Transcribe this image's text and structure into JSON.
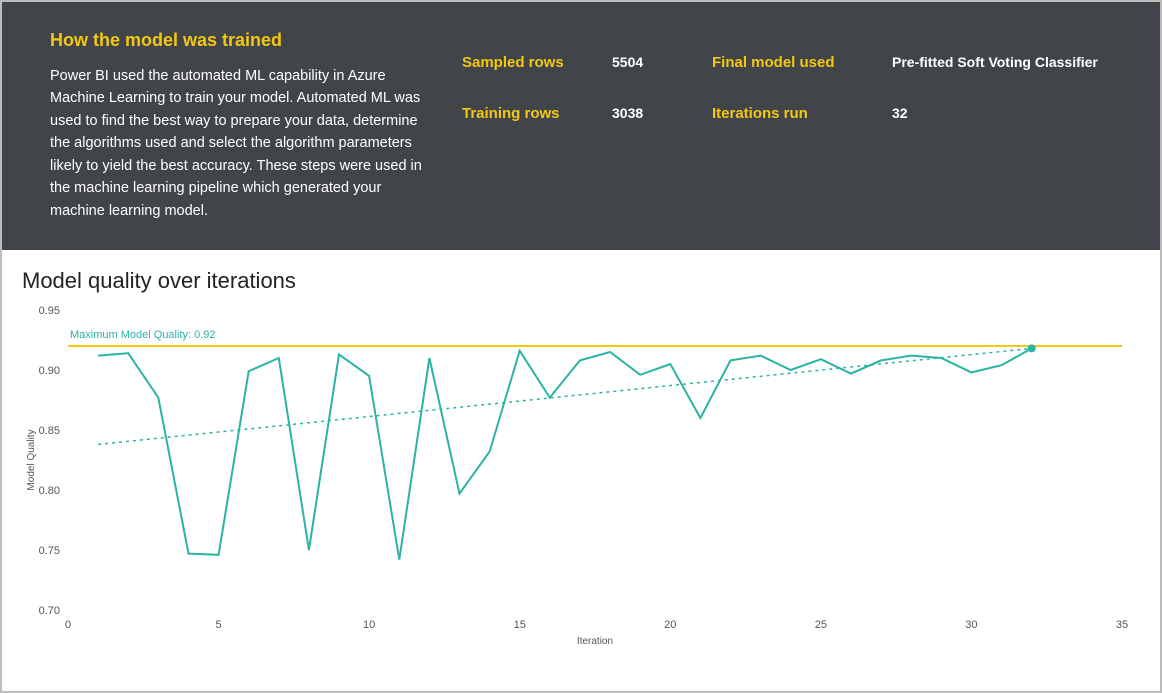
{
  "header": {
    "title": "How the model was trained",
    "description": "Power BI used the automated ML capability in Azure Machine Learning to train your model. Automated ML was used to find the best way to prepare your data, determine the algorithms used and select the algorithm parameters likely to yield the best accuracy. These steps were used in the machine learning pipeline which generated your machine learning model."
  },
  "stats": {
    "sampled_rows_label": "Sampled rows",
    "sampled_rows_value": "5504",
    "training_rows_label": "Training rows",
    "training_rows_value": "3038",
    "final_model_label": "Final model used",
    "final_model_value": "Pre-fitted Soft Voting Classifier",
    "iterations_run_label": "Iterations run",
    "iterations_run_value": "32"
  },
  "chart": {
    "title": "Model quality over iterations",
    "xlabel": "Iteration",
    "ylabel": "Model Quality",
    "reference_label": "Maximum Model Quality: 0.92"
  },
  "chart_data": {
    "type": "line",
    "title": "Model quality over iterations",
    "xlabel": "Iteration",
    "ylabel": "Model Quality",
    "xlim": [
      0,
      35
    ],
    "ylim": [
      0.7,
      0.95
    ],
    "x_ticks": [
      0,
      5,
      10,
      15,
      20,
      25,
      30,
      35
    ],
    "y_ticks": [
      0.7,
      0.75,
      0.8,
      0.85,
      0.9,
      0.95
    ],
    "reference": {
      "label": "Maximum Model Quality: 0.92",
      "value": 0.92
    },
    "trend": {
      "x1": 1,
      "y1": 0.838,
      "x2": 32,
      "y2": 0.918
    },
    "series": [
      {
        "name": "Model Quality",
        "x": [
          1,
          2,
          3,
          4,
          5,
          6,
          7,
          8,
          9,
          10,
          11,
          12,
          13,
          14,
          15,
          16,
          17,
          18,
          19,
          20,
          21,
          22,
          23,
          24,
          25,
          26,
          27,
          28,
          29,
          30,
          31,
          32
        ],
        "values": [
          0.912,
          0.914,
          0.877,
          0.747,
          0.746,
          0.899,
          0.91,
          0.75,
          0.913,
          0.895,
          0.742,
          0.91,
          0.797,
          0.832,
          0.916,
          0.877,
          0.908,
          0.915,
          0.896,
          0.905,
          0.86,
          0.908,
          0.912,
          0.9,
          0.909,
          0.897,
          0.908,
          0.912,
          0.91,
          0.898,
          0.904,
          0.918
        ]
      }
    ]
  }
}
